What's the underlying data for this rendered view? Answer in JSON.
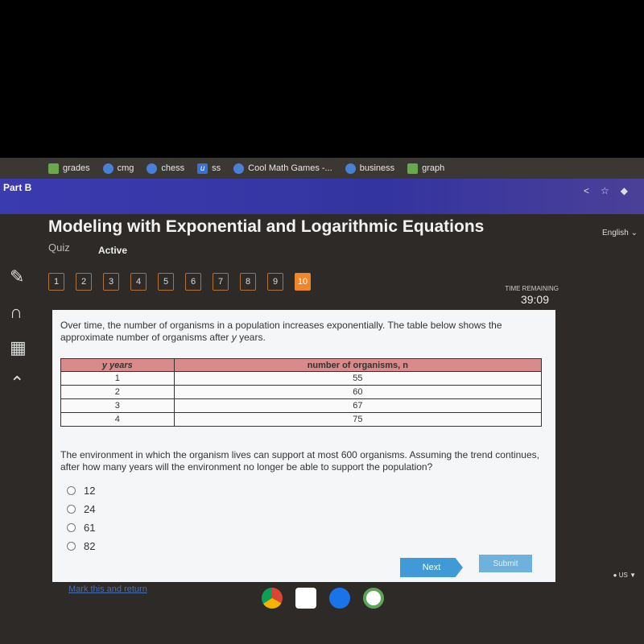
{
  "bookmarks": [
    {
      "label": "grades",
      "icon": "sheets-icon"
    },
    {
      "label": "cmg",
      "icon": "coolmath-icon"
    },
    {
      "label": "chess",
      "icon": "coolmath-icon"
    },
    {
      "label": "ss",
      "icon": "u-icon"
    },
    {
      "label": "Cool Math Games -...",
      "icon": "coolmath-icon"
    },
    {
      "label": "business",
      "icon": "coolmath-icon"
    },
    {
      "label": "graph",
      "icon": "graph-icon"
    }
  ],
  "header": {
    "part": "Part B",
    "language": "English"
  },
  "quiz": {
    "title": "Modeling with Exponential and Logarithmic Equations",
    "type": "Quiz",
    "status": "Active",
    "questions": [
      "1",
      "2",
      "3",
      "4",
      "5",
      "6",
      "7",
      "8",
      "9",
      "10"
    ],
    "current": "10",
    "timer_label": "TIME REMAINING",
    "timer": "39:09"
  },
  "question": {
    "prompt_a": "Over time, the number of organisms in a population increases exponentially. The table below shows the approximate number of organisms after ",
    "prompt_var": "y",
    "prompt_b": " years.",
    "table": {
      "headers": [
        "y years",
        "number of organisms, n"
      ],
      "rows": [
        [
          "1",
          "55"
        ],
        [
          "2",
          "60"
        ],
        [
          "3",
          "67"
        ],
        [
          "4",
          "75"
        ]
      ]
    },
    "question": "The environment in which the organism lives can support at most 600 organisms. Assuming the trend continues, after how many years will the environment no longer be able to support the population?",
    "choices": [
      "12",
      "24",
      "61",
      "82"
    ]
  },
  "buttons": {
    "next": "Next",
    "submit": "Submit",
    "mark": "Mark this and return"
  },
  "tray": {
    "region": "US"
  },
  "colors": {
    "accent": "#f0862a",
    "header": "#3434a0",
    "table_header": "#d98a8a",
    "button": "#3f9ad6"
  }
}
